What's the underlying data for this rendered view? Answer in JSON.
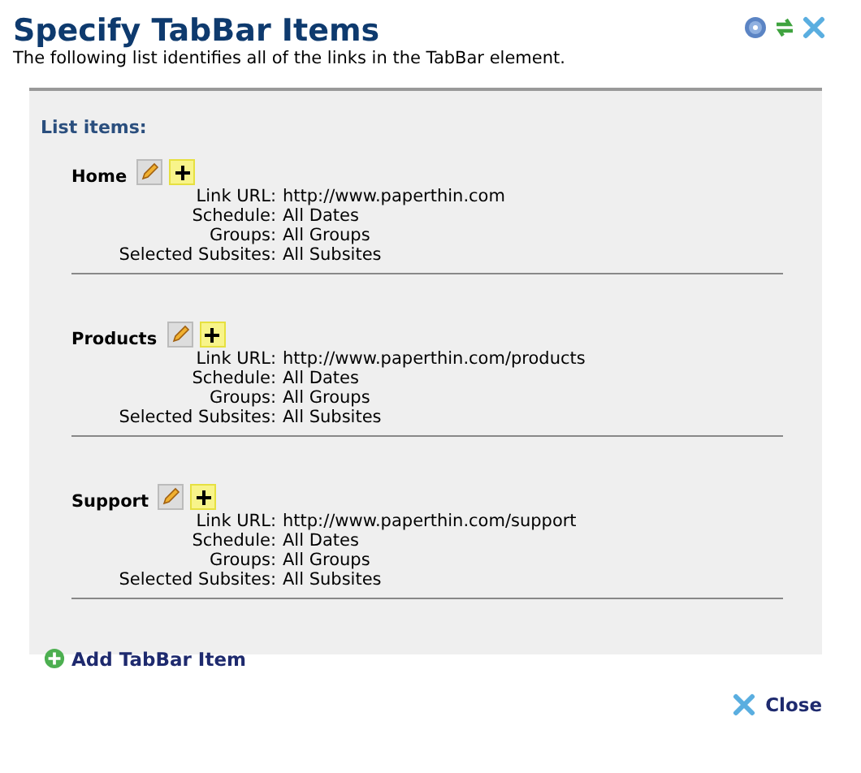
{
  "title": "Specify TabBar Items",
  "description": "The following list identifies all of the links in the TabBar element.",
  "list_heading": "List items:",
  "items": [
    {
      "name": "Home",
      "fields": [
        {
          "label": "Link URL:",
          "value": "http://www.paperthin.com"
        },
        {
          "label": "Schedule:",
          "value": "All Dates"
        },
        {
          "label": "Groups:",
          "value": "All Groups"
        },
        {
          "label": "Selected Subsites:",
          "value": "All Subsites"
        }
      ]
    },
    {
      "name": "Products",
      "fields": [
        {
          "label": "Link URL:",
          "value": "http://www.paperthin.com/products"
        },
        {
          "label": "Schedule:",
          "value": "All Dates"
        },
        {
          "label": "Groups:",
          "value": "All Groups"
        },
        {
          "label": "Selected Subsites:",
          "value": "All Subsites"
        }
      ]
    },
    {
      "name": "Support",
      "fields": [
        {
          "label": "Link URL:",
          "value": "http://www.paperthin.com/support"
        },
        {
          "label": "Schedule:",
          "value": "All Dates"
        },
        {
          "label": "Groups:",
          "value": "All Groups"
        },
        {
          "label": "Selected Subsites:",
          "value": "All Subsites"
        }
      ]
    }
  ],
  "add_link": "Add TabBar Item",
  "close_button": "Close"
}
